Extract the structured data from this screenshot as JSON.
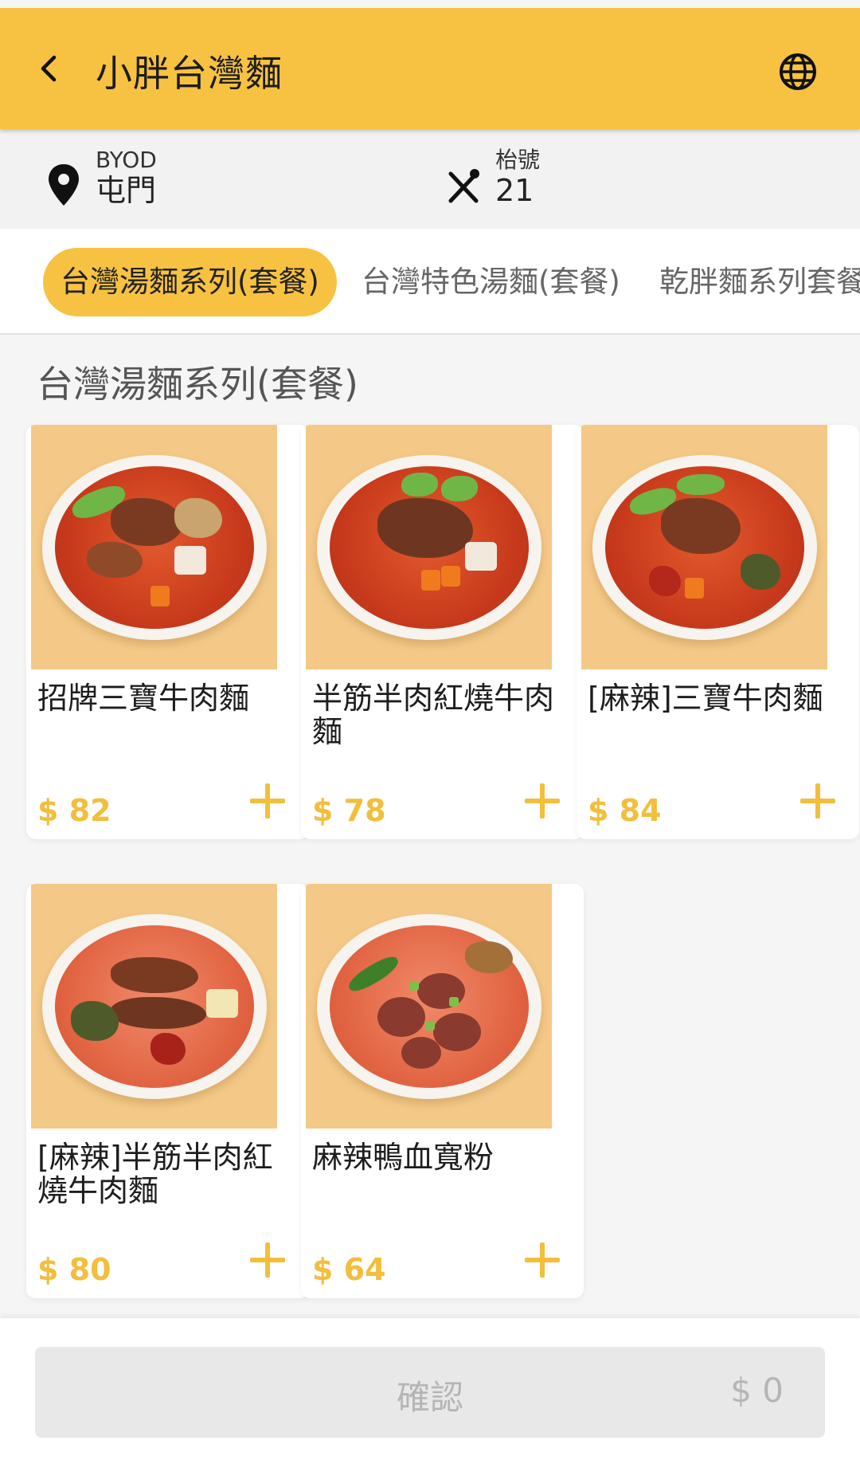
{
  "header": {
    "title": "小胖台灣麵"
  },
  "info": {
    "location_label": "BYOD",
    "location_value": "屯門",
    "table_label": "枱號",
    "table_value": "21"
  },
  "tabs": [
    {
      "label": "台灣湯麵系列(套餐)",
      "active": true
    },
    {
      "label": "台灣特色湯麵(套餐)",
      "active": false
    },
    {
      "label": "乾胖麵系列套餐",
      "active": false
    }
  ],
  "section": {
    "title": "台灣湯麵系列(套餐)"
  },
  "items": [
    {
      "name": "招牌三寶牛肉麵",
      "price": "$ 82"
    },
    {
      "name": "半筋半肉紅燒牛肉麵",
      "price": "$ 78"
    },
    {
      "name": "[麻辣]三寶牛肉麵",
      "price": "$ 84"
    },
    {
      "name": "[麻辣]半筋半肉紅燒牛肉麵",
      "price": "$ 80"
    },
    {
      "name": "麻辣鴨血寬粉",
      "price": "$ 64"
    }
  ],
  "footer": {
    "confirm_label": "確認",
    "total": "$ 0"
  },
  "colors": {
    "accent": "#f7c242",
    "price": "#f2be3c"
  }
}
